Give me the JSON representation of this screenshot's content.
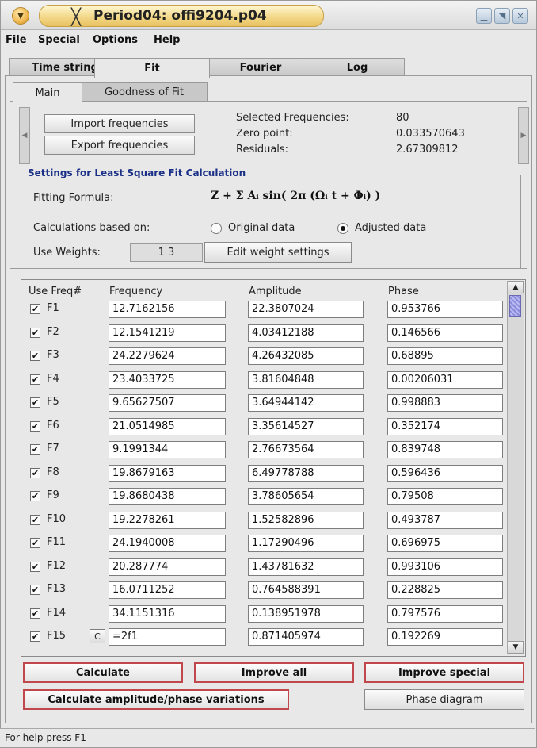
{
  "window": {
    "title": "Period04: offi9204.p04",
    "x_glyph": "╳",
    "minimize": "▁",
    "maximize": "◥",
    "close": "✕"
  },
  "menubar": [
    "File",
    "Special",
    "Options",
    "Help"
  ],
  "main_tabs": [
    "Time string",
    "Fit",
    "Fourier",
    "Log"
  ],
  "active_main_tab": "Fit",
  "sub_tabs": [
    "Main",
    "Goodness of Fit"
  ],
  "active_sub_tab": "Main",
  "freq_panel": {
    "import_button": "Import frequencies",
    "export_button": "Export frequencies",
    "selected_label": "Selected Frequencies:",
    "selected_value": "80",
    "zero_label": "Zero point:",
    "zero_value": "0.033570643",
    "residuals_label": "Residuals:",
    "residuals_value": "2.67309812"
  },
  "settings": {
    "group_title": "Settings for Least Square Fit Calculation",
    "fitting_label": "Fitting Formula:",
    "formula": "Z + Σ Aᵢ sin( 2π (Ωᵢ t + Φᵢ) )",
    "calc_label": "Calculations based on:",
    "option_original": "Original data",
    "option_adjusted": "Adjusted data",
    "selected_option": "Adjusted data",
    "weights_label": "Use Weights:",
    "weights_value": "1 3",
    "edit_weights_button": "Edit weight settings"
  },
  "table": {
    "headers": {
      "use": "Use Freq#",
      "frequency": "Frequency",
      "amplitude": "Amplitude",
      "phase": "Phase"
    },
    "rows": [
      {
        "id": "F1",
        "checked": true,
        "frequency": "12.7162156",
        "amplitude": "22.3807024",
        "phase": "0.953766"
      },
      {
        "id": "F2",
        "checked": true,
        "frequency": "12.1541219",
        "amplitude": "4.03412188",
        "phase": "0.146566"
      },
      {
        "id": "F3",
        "checked": true,
        "frequency": "24.2279624",
        "amplitude": "4.26432085",
        "phase": "0.68895"
      },
      {
        "id": "F4",
        "checked": true,
        "frequency": "23.4033725",
        "amplitude": "3.81604848",
        "phase": "0.00206031"
      },
      {
        "id": "F5",
        "checked": true,
        "frequency": "9.65627507",
        "amplitude": "3.64944142",
        "phase": "0.998883"
      },
      {
        "id": "F6",
        "checked": true,
        "frequency": "21.0514985",
        "amplitude": "3.35614527",
        "phase": "0.352174"
      },
      {
        "id": "F7",
        "checked": true,
        "frequency": "9.1991344",
        "amplitude": "2.76673564",
        "phase": "0.839748"
      },
      {
        "id": "F8",
        "checked": true,
        "frequency": "19.8679163",
        "amplitude": "6.49778788",
        "phase": "0.596436"
      },
      {
        "id": "F9",
        "checked": true,
        "frequency": "19.8680438",
        "amplitude": "3.78605654",
        "phase": "0.79508"
      },
      {
        "id": "F10",
        "checked": true,
        "frequency": "19.2278261",
        "amplitude": "1.52582896",
        "phase": "0.493787"
      },
      {
        "id": "F11",
        "checked": true,
        "frequency": "24.1940008",
        "amplitude": "1.17290496",
        "phase": "0.696975"
      },
      {
        "id": "F12",
        "checked": true,
        "frequency": "20.287774",
        "amplitude": "1.43781632",
        "phase": "0.993106"
      },
      {
        "id": "F13",
        "checked": true,
        "frequency": "16.0711252",
        "amplitude": "0.764588391",
        "phase": "0.228825"
      },
      {
        "id": "F14",
        "checked": true,
        "frequency": "34.1151316",
        "amplitude": "0.138951978",
        "phase": "0.797576"
      },
      {
        "id": "F15",
        "checked": true,
        "frequency": "=2f1",
        "amplitude": "0.871405974",
        "phase": "0.192269",
        "composite_button": "C"
      }
    ],
    "check_glyph": "✔"
  },
  "actions": {
    "calculate": "Calculate",
    "improve_all": "Improve all",
    "improve_special": "Improve special",
    "calc_amp_phase": "Calculate amplitude/phase variations",
    "phase_diagram": "Phase diagram"
  },
  "status": "For help press F1",
  "colors": {
    "accent_red": "#c0474b",
    "group_title_blue": "#1a2f86",
    "title_gold": "#f3d98a"
  }
}
